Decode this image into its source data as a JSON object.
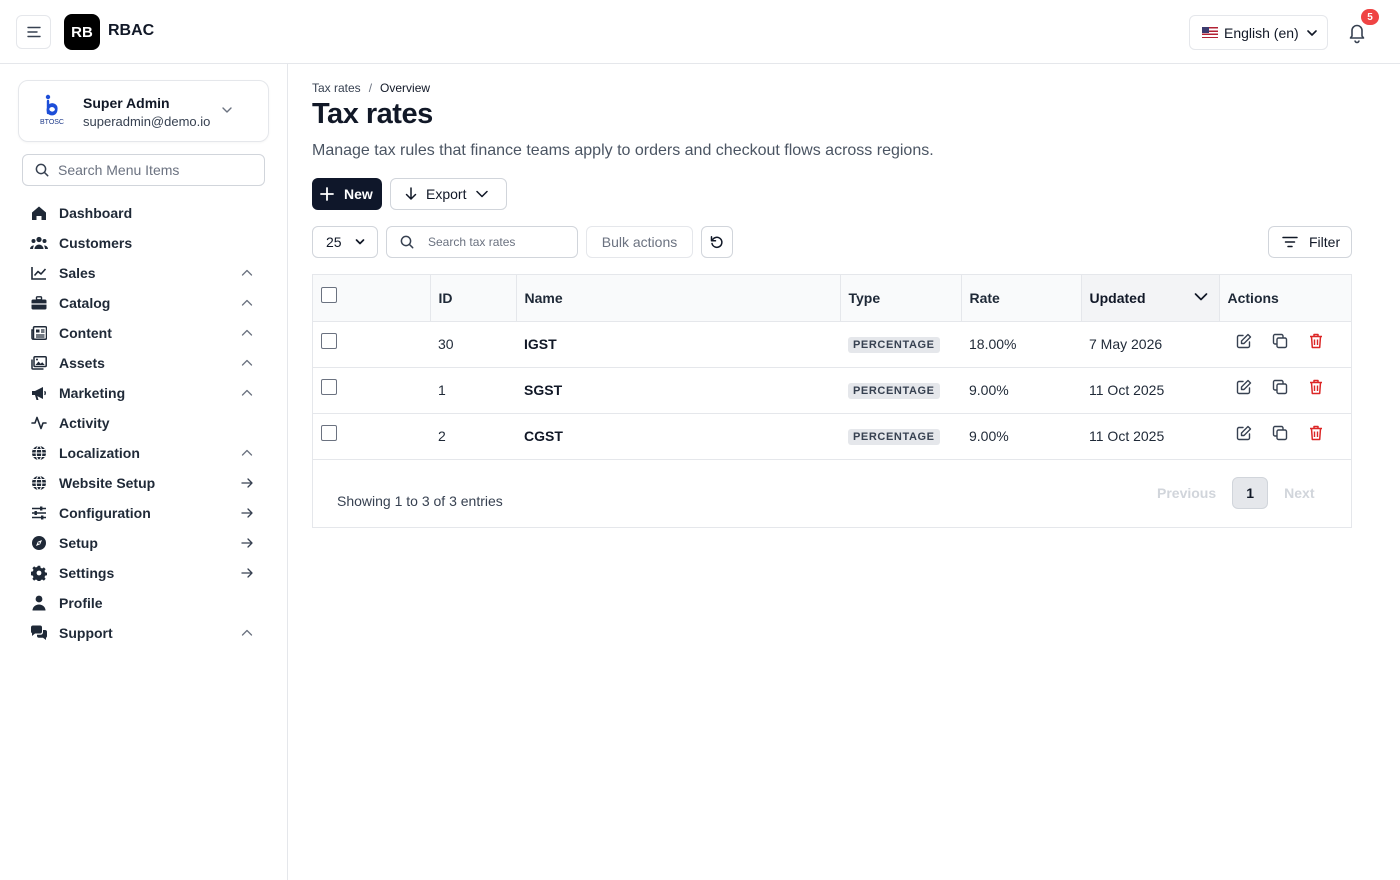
{
  "app": {
    "logo_text": "RB",
    "title": "RBAC"
  },
  "topbar": {
    "language": "English (en)",
    "notification_count": "5"
  },
  "user": {
    "logo_text": "BTOSC",
    "name": "Super Admin",
    "email": "superadmin@demo.io"
  },
  "sidebar": {
    "search_placeholder": "Search Menu Items",
    "items": [
      {
        "label": "Dashboard",
        "icon": "home-icon",
        "trail": "none"
      },
      {
        "label": "Customers",
        "icon": "users-icon",
        "trail": "none"
      },
      {
        "label": "Sales",
        "icon": "chart-line-icon",
        "trail": "chevron-up"
      },
      {
        "label": "Catalog",
        "icon": "briefcase-icon",
        "trail": "chevron-up"
      },
      {
        "label": "Content",
        "icon": "newspaper-icon",
        "trail": "chevron-up"
      },
      {
        "label": "Assets",
        "icon": "images-icon",
        "trail": "chevron-up"
      },
      {
        "label": "Marketing",
        "icon": "megaphone-icon",
        "trail": "chevron-up"
      },
      {
        "label": "Activity",
        "icon": "activity-icon",
        "trail": "none"
      },
      {
        "label": "Localization",
        "icon": "globe-icon",
        "trail": "chevron-up"
      },
      {
        "label": "Website Setup",
        "icon": "globe-icon",
        "trail": "arrow-right"
      },
      {
        "label": "Configuration",
        "icon": "sliders-icon",
        "trail": "arrow-right"
      },
      {
        "label": "Setup",
        "icon": "compass-icon",
        "trail": "arrow-right"
      },
      {
        "label": "Settings",
        "icon": "gear-icon",
        "trail": "arrow-right"
      },
      {
        "label": "Profile",
        "icon": "user-icon",
        "trail": "none"
      },
      {
        "label": "Support",
        "icon": "chat-icon",
        "trail": "chevron-up"
      }
    ]
  },
  "breadcrumb": {
    "parent": "Tax rates",
    "separator": "/",
    "current": "Overview"
  },
  "page": {
    "title": "Tax rates",
    "description": "Manage tax rules that finance teams apply to orders and checkout flows across regions."
  },
  "toolbar": {
    "new_label": "New",
    "export_label": "Export",
    "per_page": "25",
    "search_placeholder": "Search tax rates",
    "bulk_label": "Bulk actions",
    "filter_label": "Filter"
  },
  "table": {
    "columns": [
      "",
      "ID",
      "Name",
      "Type",
      "Rate",
      "Updated",
      "Actions"
    ],
    "sorted_column": "Updated",
    "rows": [
      {
        "id": "30",
        "name": "IGST",
        "type": "PERCENTAGE",
        "rate": "18.00%",
        "updated": "7 May 2026"
      },
      {
        "id": "1",
        "name": "SGST",
        "type": "PERCENTAGE",
        "rate": "9.00%",
        "updated": "11 Oct 2025"
      },
      {
        "id": "2",
        "name": "CGST",
        "type": "PERCENTAGE",
        "rate": "9.00%",
        "updated": "11 Oct 2025"
      }
    ]
  },
  "pagination": {
    "info": "Showing 1 to 3 of 3 entries",
    "previous": "Previous",
    "current_page": "1",
    "next": "Next"
  },
  "colors": {
    "primary_button": "#0f172a",
    "delete_icon": "#dc2626",
    "badge_bg": "#e5e7eb",
    "notification_badge": "#ef4444"
  }
}
